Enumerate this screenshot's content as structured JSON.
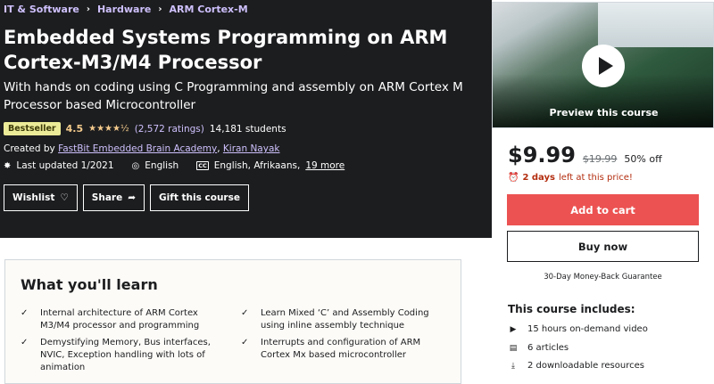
{
  "breadcrumb": {
    "items": [
      "IT & Software",
      "Hardware",
      "ARM Cortex-M"
    ],
    "separator": "›"
  },
  "course": {
    "title": "Embedded Systems Programming on ARM Cortex-M3/M4 Processor",
    "subtitle": "With hands on coding using C Programming and assembly on ARM Cortex M Processor based Microcontroller",
    "badge": "Bestseller",
    "rating": "4.5",
    "stars": "★★★★½",
    "rating_value": 4.5,
    "ratings_count": "(2,572 ratings)",
    "students": "14,181 students",
    "created_by_label": "Created by",
    "instructors": [
      "FastBit Embedded Brain Academy",
      "Kiran Nayak"
    ],
    "last_updated": "Last updated 1/2021",
    "language": "English",
    "captions": "English, Afrikaans,",
    "captions_more": "19 more"
  },
  "actions": {
    "wishlist": "Wishlist",
    "share": "Share",
    "gift": "Gift this course"
  },
  "learn": {
    "heading": "What you'll learn",
    "items": [
      "Internal architecture of ARM Cortex M3/M4 processor and programming",
      "Learn Mixed ‘C’ and Assembly Coding using inline assembly technique",
      "Demystifying Memory, Bus interfaces, NVIC, Exception handling with lots of animation",
      "Interrupts and configuration of ARM Cortex Mx based microcontroller"
    ]
  },
  "sidebar": {
    "preview_label": "Preview this course",
    "price": "$9.99",
    "original_price": "$19.99",
    "discount": "50% off",
    "timer_bold": "2 days",
    "timer_rest": "left at this price!",
    "add_to_cart": "Add to cart",
    "buy_now": "Buy now",
    "guarantee": "30-Day Money-Back Guarantee",
    "includes_heading": "This course includes:",
    "includes": [
      "15 hours on-demand video",
      "6 articles",
      "2 downloadable resources"
    ]
  },
  "colors": {
    "hero_bg": "#1c1d1f",
    "link_purple": "#cec0fc",
    "star_gold": "#f3ca8c",
    "badge_bg": "#eceb98",
    "cart_red": "#ec5252",
    "timer_red": "#b32d0f"
  },
  "icons": {
    "breadcrumb_separator": "chevron-right-icon",
    "wishlist": "heart-icon",
    "share": "share-arrow-icon",
    "last_updated": "alert-badge-icon",
    "language": "globe-icon",
    "captions": "closed-captions-icon",
    "learn_item": "check-icon",
    "timer": "alarm-clock-icon",
    "play": "play-icon",
    "video": "video-icon",
    "article": "article-icon",
    "download": "download-icon"
  }
}
